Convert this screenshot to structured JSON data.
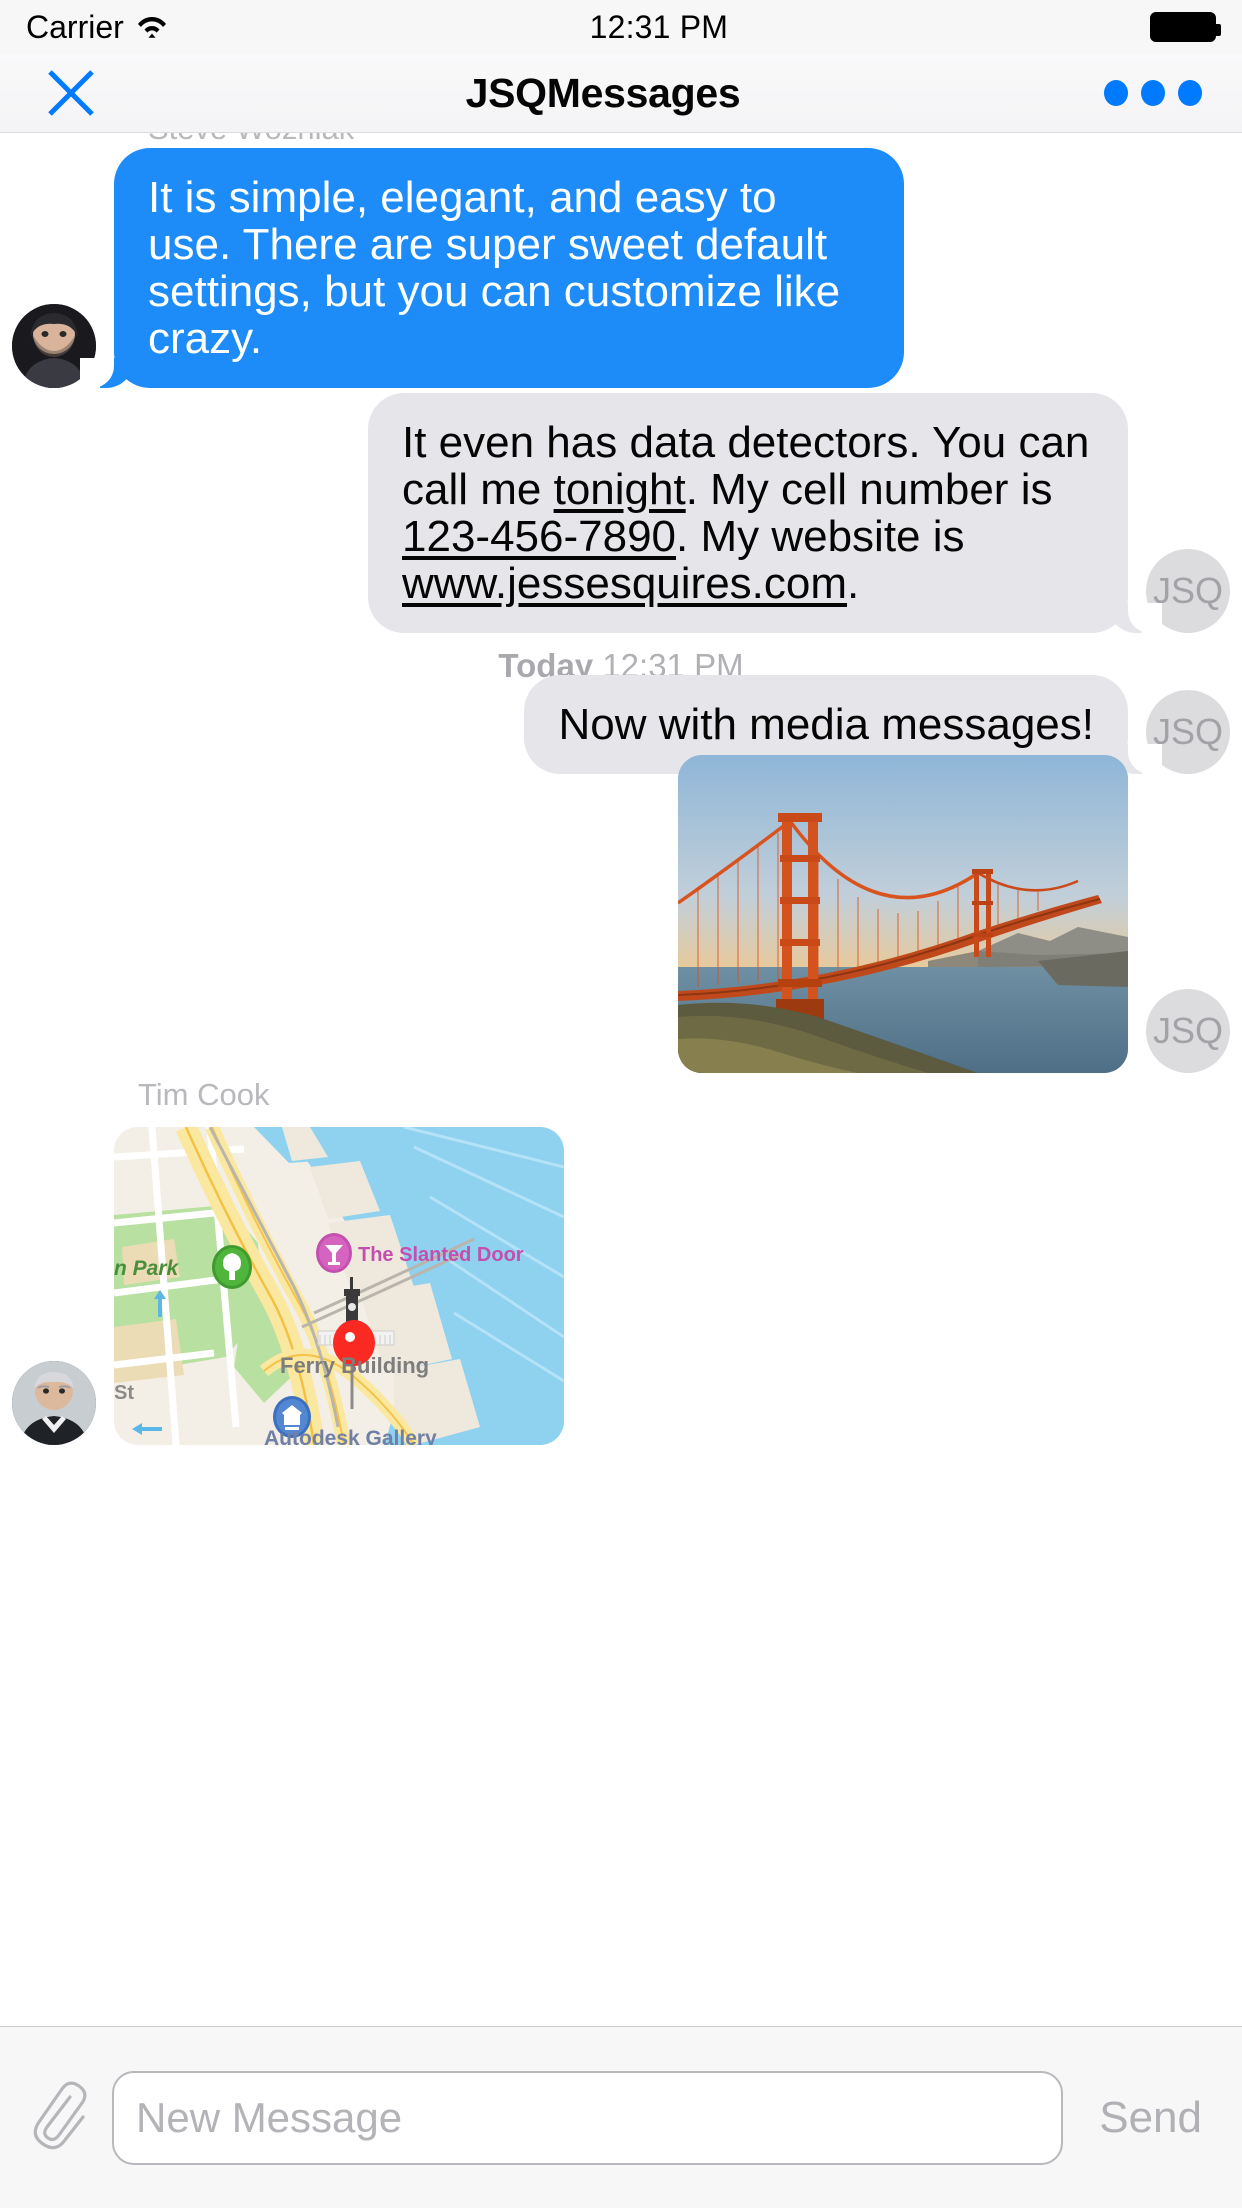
{
  "status_bar": {
    "carrier": "Carrier",
    "time": "12:31 PM",
    "wifi_icon": "wifi-icon",
    "battery_icon": "battery-full-icon"
  },
  "nav_bar": {
    "close_icon": "close-x-icon",
    "title": "JSQMessages",
    "more_icon": "more-dots-icon"
  },
  "conversation": {
    "messages": [
      {
        "id": "m1",
        "sender": "Steve Wozniak",
        "direction": "incoming",
        "type": "text",
        "text": "It is simple, elegant, and easy to use. There are super sweet default settings, but you can customize like crazy.",
        "avatar": "steve-wozniak-avatar"
      },
      {
        "id": "m2",
        "sender": "JSQ",
        "direction": "outgoing",
        "type": "text",
        "text_parts": [
          {
            "t": "It even has data detectors. You can call me ",
            "link": false
          },
          {
            "t": "tonight",
            "link": true
          },
          {
            "t": ". My cell number is ",
            "link": false
          },
          {
            "t": "123-456-7890",
            "link": true
          },
          {
            "t": ". My website is ",
            "link": false
          },
          {
            "t": "www.jessesquires.com",
            "link": true
          },
          {
            "t": ".",
            "link": false
          }
        ],
        "avatar_initials": "JSQ"
      },
      {
        "id": "sep1",
        "type": "timestamp",
        "day": "Today",
        "time": "12:31 PM"
      },
      {
        "id": "m3",
        "sender": "JSQ",
        "direction": "outgoing",
        "type": "text",
        "text": "Now with media messages!",
        "avatar_initials": "JSQ"
      },
      {
        "id": "m4",
        "sender": "JSQ",
        "direction": "outgoing",
        "type": "photo",
        "media_name": "golden-gate-bridge-photo",
        "avatar_initials": "JSQ"
      },
      {
        "id": "m5",
        "sender": "Tim Cook",
        "direction": "incoming",
        "type": "map",
        "media_name": "ferry-building-map",
        "avatar": "tim-cook-avatar",
        "map_labels": {
          "park": "n Park",
          "restaurant": "The Slanted Door",
          "landmark": "Ferry Building",
          "street": "St",
          "gallery": "Autodesk Gallery"
        }
      }
    ]
  },
  "toolbar": {
    "attach_icon": "paperclip-icon",
    "input_placeholder": "New Message",
    "input_value": "",
    "send_label": "Send"
  },
  "colors": {
    "outgoing_bubble": "#1d8cf8",
    "incoming_bubble": "#e6e5ea",
    "accent": "#007aff",
    "muted_text": "#b0b0b5"
  }
}
